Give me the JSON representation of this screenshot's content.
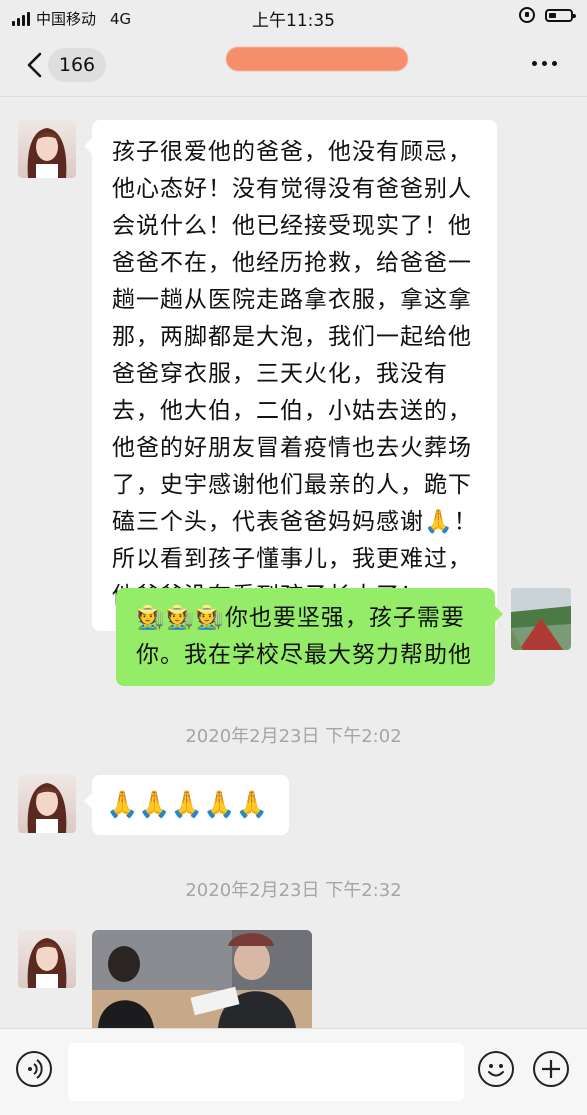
{
  "status_bar": {
    "carrier": "中国移动",
    "network": "4G",
    "time": "上午11:35"
  },
  "nav": {
    "back_count": "166",
    "contact_name": ""
  },
  "messages": [
    {
      "sender": "other",
      "type": "text",
      "text": "孩子很爱他的爸爸，他没有顾忌，他心态好！没有觉得没有爸爸别人会说什么！他已经接受现实了！他爸爸不在，他经历抢救，给爸爸一趟一趟从医院走路拿衣服，拿这拿那，两脚都是大泡，我们一起给他爸爸穿衣服，三天火化，我没有去，他大伯，二伯，小姑去送的，他爸的好朋友冒着疫情也去火葬场了，史宇感谢他们最亲的人，跪下磕三个头，代表爸爸妈妈感谢🙏！所以看到孩子懂事儿，我更难过，他爸爸没有看到孩子长大了！"
    },
    {
      "sender": "self",
      "type": "text",
      "text": "🧑‍🌾🧑‍🌾🧑‍🌾你也要坚强，孩子需要你。我在学校尽最大努力帮助他"
    },
    {
      "type": "timestamp",
      "text": "2020年2月23日 下午2:02"
    },
    {
      "sender": "other",
      "type": "text",
      "text": "🙏🙏🙏🙏🙏"
    },
    {
      "type": "timestamp",
      "text": "2020年2月23日 下午2:32"
    },
    {
      "sender": "other",
      "type": "image"
    }
  ],
  "icons": {
    "back": "chevron-left-icon",
    "more": "more-dots-icon",
    "voice": "voice-icon",
    "emoji": "smiley-icon",
    "plus": "plus-icon"
  },
  "colors": {
    "background": "#ededed",
    "self_bubble": "#95ec69",
    "other_bubble": "#ffffff",
    "timestamp": "#a5a5a5"
  }
}
